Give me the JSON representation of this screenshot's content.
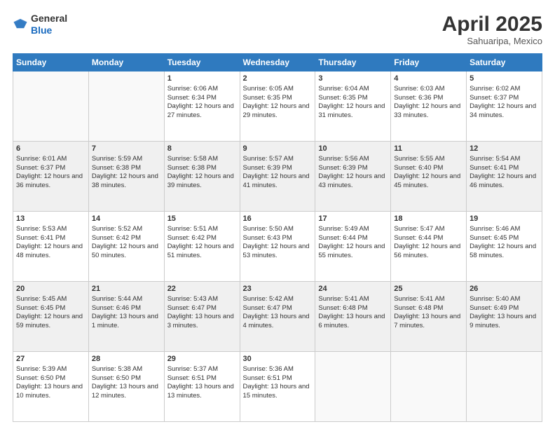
{
  "header": {
    "logo_general": "General",
    "logo_blue": "Blue",
    "month_title": "April 2025",
    "location": "Sahuaripa, Mexico"
  },
  "days_of_week": [
    "Sunday",
    "Monday",
    "Tuesday",
    "Wednesday",
    "Thursday",
    "Friday",
    "Saturday"
  ],
  "weeks": [
    [
      {
        "day": "",
        "content": ""
      },
      {
        "day": "",
        "content": ""
      },
      {
        "day": "1",
        "content": "Sunrise: 6:06 AM\nSunset: 6:34 PM\nDaylight: 12 hours and 27 minutes."
      },
      {
        "day": "2",
        "content": "Sunrise: 6:05 AM\nSunset: 6:35 PM\nDaylight: 12 hours and 29 minutes."
      },
      {
        "day": "3",
        "content": "Sunrise: 6:04 AM\nSunset: 6:35 PM\nDaylight: 12 hours and 31 minutes."
      },
      {
        "day": "4",
        "content": "Sunrise: 6:03 AM\nSunset: 6:36 PM\nDaylight: 12 hours and 33 minutes."
      },
      {
        "day": "5",
        "content": "Sunrise: 6:02 AM\nSunset: 6:37 PM\nDaylight: 12 hours and 34 minutes."
      }
    ],
    [
      {
        "day": "6",
        "content": "Sunrise: 6:01 AM\nSunset: 6:37 PM\nDaylight: 12 hours and 36 minutes."
      },
      {
        "day": "7",
        "content": "Sunrise: 5:59 AM\nSunset: 6:38 PM\nDaylight: 12 hours and 38 minutes."
      },
      {
        "day": "8",
        "content": "Sunrise: 5:58 AM\nSunset: 6:38 PM\nDaylight: 12 hours and 39 minutes."
      },
      {
        "day": "9",
        "content": "Sunrise: 5:57 AM\nSunset: 6:39 PM\nDaylight: 12 hours and 41 minutes."
      },
      {
        "day": "10",
        "content": "Sunrise: 5:56 AM\nSunset: 6:39 PM\nDaylight: 12 hours and 43 minutes."
      },
      {
        "day": "11",
        "content": "Sunrise: 5:55 AM\nSunset: 6:40 PM\nDaylight: 12 hours and 45 minutes."
      },
      {
        "day": "12",
        "content": "Sunrise: 5:54 AM\nSunset: 6:41 PM\nDaylight: 12 hours and 46 minutes."
      }
    ],
    [
      {
        "day": "13",
        "content": "Sunrise: 5:53 AM\nSunset: 6:41 PM\nDaylight: 12 hours and 48 minutes."
      },
      {
        "day": "14",
        "content": "Sunrise: 5:52 AM\nSunset: 6:42 PM\nDaylight: 12 hours and 50 minutes."
      },
      {
        "day": "15",
        "content": "Sunrise: 5:51 AM\nSunset: 6:42 PM\nDaylight: 12 hours and 51 minutes."
      },
      {
        "day": "16",
        "content": "Sunrise: 5:50 AM\nSunset: 6:43 PM\nDaylight: 12 hours and 53 minutes."
      },
      {
        "day": "17",
        "content": "Sunrise: 5:49 AM\nSunset: 6:44 PM\nDaylight: 12 hours and 55 minutes."
      },
      {
        "day": "18",
        "content": "Sunrise: 5:47 AM\nSunset: 6:44 PM\nDaylight: 12 hours and 56 minutes."
      },
      {
        "day": "19",
        "content": "Sunrise: 5:46 AM\nSunset: 6:45 PM\nDaylight: 12 hours and 58 minutes."
      }
    ],
    [
      {
        "day": "20",
        "content": "Sunrise: 5:45 AM\nSunset: 6:45 PM\nDaylight: 12 hours and 59 minutes."
      },
      {
        "day": "21",
        "content": "Sunrise: 5:44 AM\nSunset: 6:46 PM\nDaylight: 13 hours and 1 minute."
      },
      {
        "day": "22",
        "content": "Sunrise: 5:43 AM\nSunset: 6:47 PM\nDaylight: 13 hours and 3 minutes."
      },
      {
        "day": "23",
        "content": "Sunrise: 5:42 AM\nSunset: 6:47 PM\nDaylight: 13 hours and 4 minutes."
      },
      {
        "day": "24",
        "content": "Sunrise: 5:41 AM\nSunset: 6:48 PM\nDaylight: 13 hours and 6 minutes."
      },
      {
        "day": "25",
        "content": "Sunrise: 5:41 AM\nSunset: 6:48 PM\nDaylight: 13 hours and 7 minutes."
      },
      {
        "day": "26",
        "content": "Sunrise: 5:40 AM\nSunset: 6:49 PM\nDaylight: 13 hours and 9 minutes."
      }
    ],
    [
      {
        "day": "27",
        "content": "Sunrise: 5:39 AM\nSunset: 6:50 PM\nDaylight: 13 hours and 10 minutes."
      },
      {
        "day": "28",
        "content": "Sunrise: 5:38 AM\nSunset: 6:50 PM\nDaylight: 13 hours and 12 minutes."
      },
      {
        "day": "29",
        "content": "Sunrise: 5:37 AM\nSunset: 6:51 PM\nDaylight: 13 hours and 13 minutes."
      },
      {
        "day": "30",
        "content": "Sunrise: 5:36 AM\nSunset: 6:51 PM\nDaylight: 13 hours and 15 minutes."
      },
      {
        "day": "",
        "content": ""
      },
      {
        "day": "",
        "content": ""
      },
      {
        "day": "",
        "content": ""
      }
    ]
  ]
}
